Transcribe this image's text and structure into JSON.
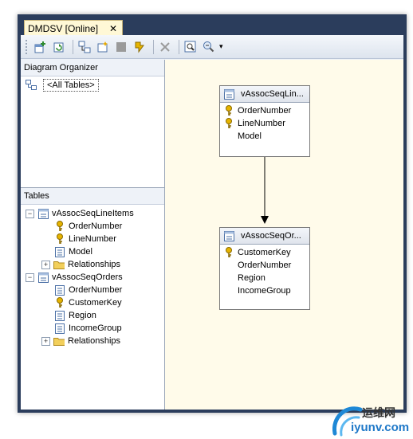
{
  "window": {
    "tab_title": "DMDSV [Online]",
    "close_glyph": "✕"
  },
  "toolbar": {
    "icons": [
      "add-table-icon",
      "refresh-icon",
      "new-relationship-icon",
      "new-named-query-icon",
      "new-named-calc-icon",
      "replace-table-icon",
      "delete-icon",
      "find-table-icon",
      "zoom-icon"
    ],
    "dropdown_glyph": "▾"
  },
  "organizer": {
    "header": "Diagram Organizer",
    "item": "<All Tables>"
  },
  "tables": {
    "header": "Tables",
    "tree": [
      {
        "label": "vAssocSeqLineItems",
        "expand": "−",
        "children": [
          {
            "label": "OrderNumber",
            "icon": "key"
          },
          {
            "label": "LineNumber",
            "icon": "key"
          },
          {
            "label": "Model",
            "icon": "column"
          },
          {
            "label": "Relationships",
            "icon": "folder",
            "expand": "+"
          }
        ]
      },
      {
        "label": "vAssocSeqOrders",
        "expand": "−",
        "children": [
          {
            "label": "OrderNumber",
            "icon": "column"
          },
          {
            "label": "CustomerKey",
            "icon": "key"
          },
          {
            "label": "Region",
            "icon": "column"
          },
          {
            "label": "IncomeGroup",
            "icon": "column"
          },
          {
            "label": "Relationships",
            "icon": "folder",
            "expand": "+"
          }
        ]
      }
    ]
  },
  "diagram": {
    "table1": {
      "title": "vAssocSeqLin...",
      "columns": [
        {
          "name": "OrderNumber",
          "key": true
        },
        {
          "name": "LineNumber",
          "key": true
        },
        {
          "name": "Model",
          "key": false
        }
      ]
    },
    "table2": {
      "title": "vAssocSeqOr...",
      "columns": [
        {
          "name": "CustomerKey",
          "key": true
        },
        {
          "name": "OrderNumber",
          "key": false
        },
        {
          "name": "Region",
          "key": false
        },
        {
          "name": "IncomeGroup",
          "key": false
        }
      ]
    }
  },
  "watermark": {
    "cn": "运维网",
    "url": "iyunv.com"
  }
}
